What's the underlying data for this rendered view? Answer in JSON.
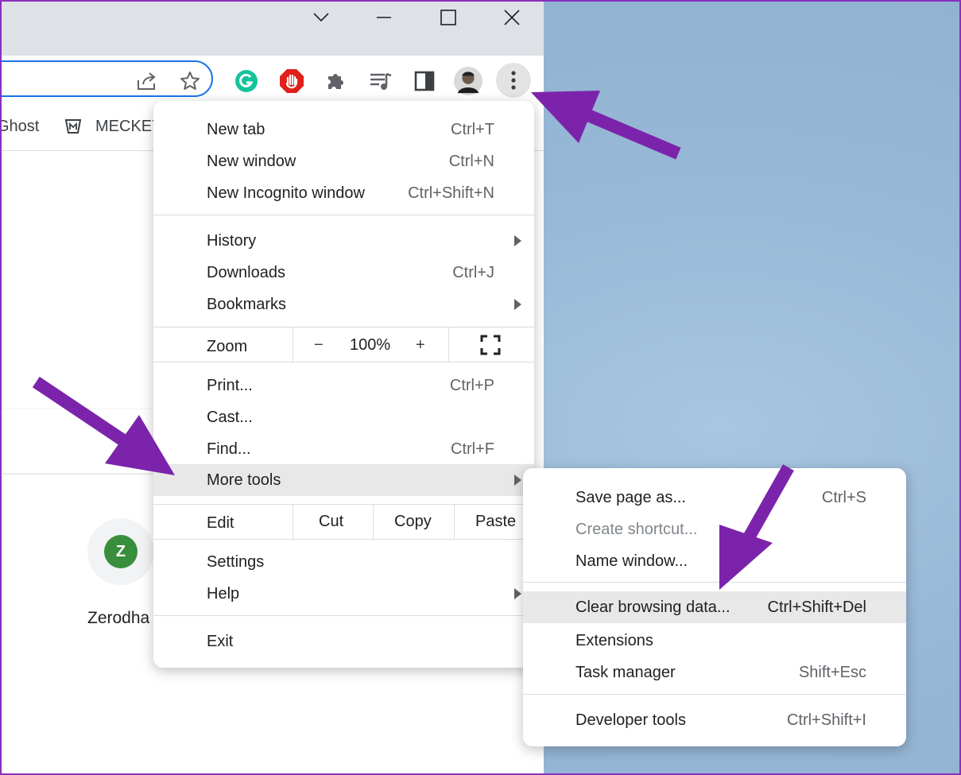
{
  "browser": {
    "toolbar": {
      "share_icon": "share-icon",
      "bookmark_star_icon": "star-icon",
      "extensions": [
        "grammarly-icon",
        "adblock-icon",
        "puzzle-icon",
        "media-queue-icon",
        "side-panel-icon"
      ],
      "profile": "avatar",
      "menu_icon": "three-dots-vertical-icon"
    },
    "bookmarks": [
      {
        "label": "Ghost"
      },
      {
        "label": "MECKEY",
        "icon": "meckey-icon"
      }
    ],
    "shortcut": {
      "initial": "Z",
      "name": "Zerodha",
      "color": "#388e3c"
    }
  },
  "menu": {
    "new_tab": {
      "label": "New tab",
      "shortcut": "Ctrl+T"
    },
    "new_window": {
      "label": "New window",
      "shortcut": "Ctrl+N"
    },
    "new_incognito": {
      "label": "New Incognito window",
      "shortcut": "Ctrl+Shift+N"
    },
    "history": {
      "label": "History"
    },
    "downloads": {
      "label": "Downloads",
      "shortcut": "Ctrl+J"
    },
    "bookmarks": {
      "label": "Bookmarks"
    },
    "zoom": {
      "label": "Zoom",
      "minus": "−",
      "value": "100%",
      "plus": "+"
    },
    "print": {
      "label": "Print...",
      "shortcut": "Ctrl+P"
    },
    "cast": {
      "label": "Cast..."
    },
    "find": {
      "label": "Find...",
      "shortcut": "Ctrl+F"
    },
    "more_tools": {
      "label": "More tools"
    },
    "edit": {
      "label": "Edit",
      "cut": "Cut",
      "copy": "Copy",
      "paste": "Paste"
    },
    "settings": {
      "label": "Settings"
    },
    "help": {
      "label": "Help"
    },
    "exit": {
      "label": "Exit"
    }
  },
  "submenu": {
    "save_page": {
      "label": "Save page as...",
      "shortcut": "Ctrl+S"
    },
    "create_shortcut": {
      "label": "Create shortcut..."
    },
    "name_window": {
      "label": "Name window..."
    },
    "clear_data": {
      "label": "Clear browsing data...",
      "shortcut": "Ctrl+Shift+Del"
    },
    "extensions": {
      "label": "Extensions"
    },
    "task_manager": {
      "label": "Task manager",
      "shortcut": "Shift+Esc"
    },
    "dev_tools": {
      "label": "Developer tools",
      "shortcut": "Ctrl+Shift+I"
    }
  },
  "colors": {
    "accent": "#1a73e8",
    "annotation_arrow": "#7b24ab",
    "highlight": "#e8e8e9"
  }
}
